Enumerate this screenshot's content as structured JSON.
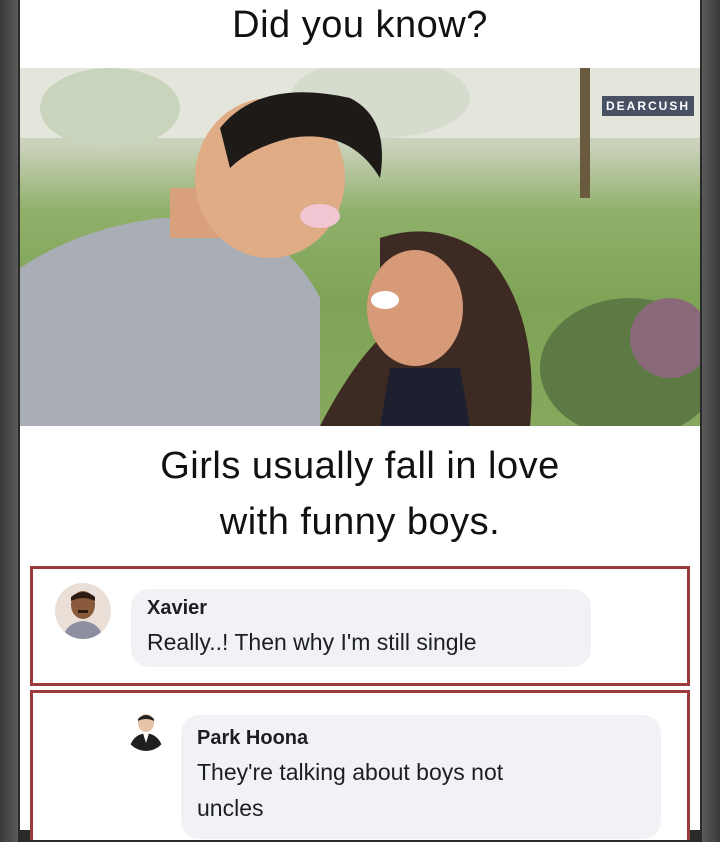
{
  "title": "Did you know?",
  "watermark": "DEARCUSH",
  "caption_line1": "Girls usually fall in love",
  "caption_line2": "with funny boys.",
  "comments": [
    {
      "name": "Xavier",
      "text": "Really..! Then why I'm still single"
    },
    {
      "name": "Park Hoona",
      "text_line1": "They're talking about boys not",
      "text_line2": "uncles"
    }
  ]
}
